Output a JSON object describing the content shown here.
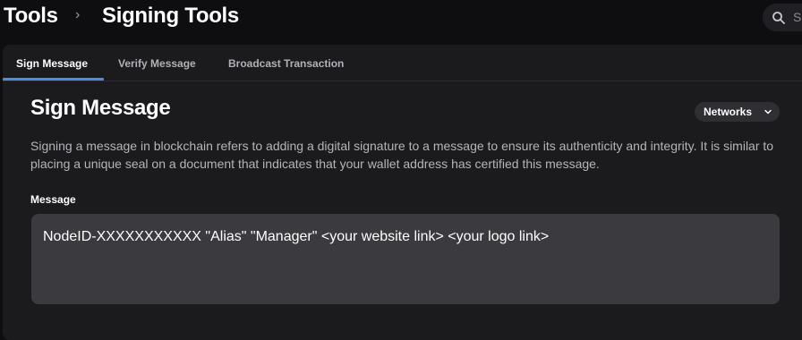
{
  "breadcrumb": {
    "root": "Tools",
    "separator": "›",
    "current": "Signing Tools"
  },
  "search": {
    "placeholder": "S",
    "icon": "search-icon"
  },
  "tabs": [
    {
      "label": "Sign Message",
      "active": true
    },
    {
      "label": "Verify Message",
      "active": false
    },
    {
      "label": "Broadcast Transaction",
      "active": false
    }
  ],
  "main": {
    "title": "Sign Message",
    "networks_label": "Networks",
    "description": "Signing a message in blockchain refers to adding a digital signature to a message to ensure its authenticity and integrity. It is similar to placing a unique seal on a document that indicates that your wallet address has certified this message.",
    "message_label": "Message",
    "message_value": "NodeID-XXXXXXXXXXX \"Alias\" \"Manager\" <your website link> <your logo link>"
  },
  "colors": {
    "background": "#0e0e10",
    "panel": "#1b1b1e",
    "accent": "#4a8fe6",
    "input_bg": "#3a3a3f"
  }
}
